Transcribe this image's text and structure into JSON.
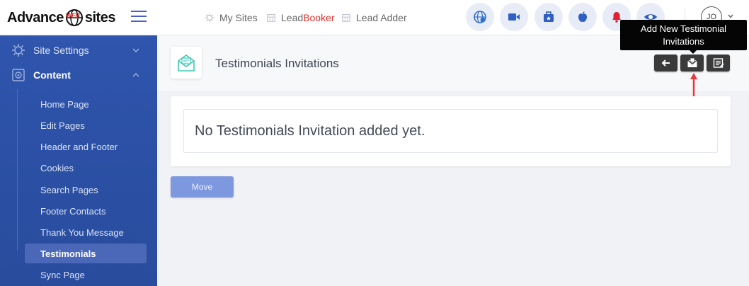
{
  "brand": {
    "logo_prefix": "Advance",
    "logo_mid": "WEB",
    "logo_suffix": "sites"
  },
  "topnav": [
    {
      "label": "My Sites",
      "icon": "gear-icon"
    },
    {
      "label_a": "Lead",
      "label_b": "Booker",
      "icon": "calendar-icon"
    },
    {
      "label": "Lead Adder",
      "icon": "calendar-icon"
    }
  ],
  "toolbar_icons": [
    "globe-gear-icon",
    "video-icon",
    "briefcase-icon",
    "apple-icon",
    "bell-icon",
    "eye-icon"
  ],
  "user": {
    "initials": "JO"
  },
  "sidebar": {
    "sections": [
      {
        "label": "Site Settings",
        "icon": "gear-icon",
        "expanded": false
      },
      {
        "label": "Content",
        "icon": "content-icon",
        "expanded": true
      }
    ],
    "items": [
      {
        "label": "Home Page"
      },
      {
        "label": "Edit Pages"
      },
      {
        "label": "Header and Footer"
      },
      {
        "label": "Cookies"
      },
      {
        "label": "Search Pages"
      },
      {
        "label": "Footer Contacts"
      },
      {
        "label": "Thank You Message"
      },
      {
        "label": "Testimonials",
        "active": true
      },
      {
        "label": "Sync Page"
      }
    ]
  },
  "page": {
    "title": "Testimonials Invitations",
    "empty_message": "No Testimonials Invitation added yet.",
    "move_label": "Move"
  },
  "actions": {
    "tooltip_line1": "Add New Testimonial",
    "tooltip_line2": "Invitations"
  },
  "colors": {
    "sidebar": "#2f55ad",
    "accent": "#4a5fc1",
    "leadbooker": "#e0302a",
    "move_button": "#7e98e0",
    "arrow": "#e8383d"
  }
}
